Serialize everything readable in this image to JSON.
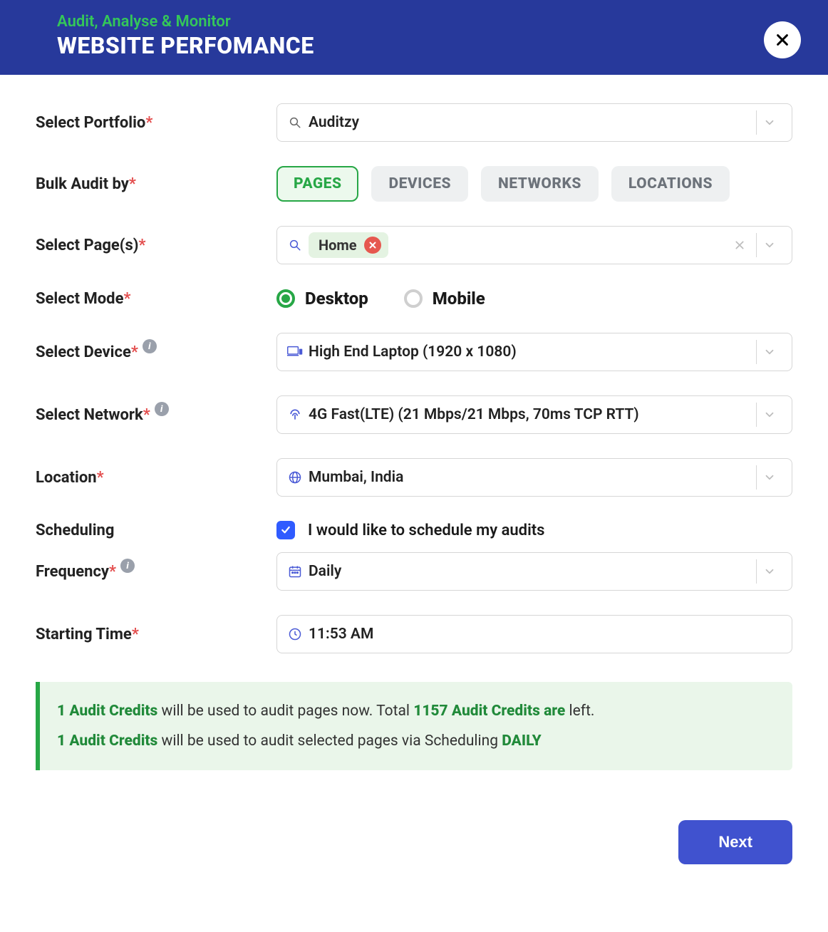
{
  "header": {
    "subtitle": "Audit, Analyse & Monitor",
    "title": "WEBSITE PERFOMANCE"
  },
  "labels": {
    "portfolio": "Select Portfolio",
    "bulk_by": "Bulk Audit by",
    "pages": "Select Page(s)",
    "mode": "Select Mode",
    "device": "Select Device",
    "network": "Select Network",
    "location": "Location",
    "scheduling": "Scheduling",
    "frequency": "Frequency",
    "starting_time": "Starting Time"
  },
  "portfolio": {
    "value": "Auditzy"
  },
  "bulk_tabs": {
    "pages": "PAGES",
    "devices": "DEVICES",
    "networks": "NETWORKS",
    "locations": "LOCATIONS",
    "active": "pages"
  },
  "selected_pages": [
    {
      "label": "Home"
    }
  ],
  "mode": {
    "desktop": "Desktop",
    "mobile": "Mobile",
    "selected": "desktop"
  },
  "device": {
    "value": "High End Laptop (1920 x 1080)"
  },
  "network": {
    "value": "4G Fast(LTE) (21 Mbps/21 Mbps, 70ms TCP RTT)"
  },
  "location": {
    "value": "Mumbai, India"
  },
  "scheduling": {
    "checked": true,
    "label": "I would like to schedule my audits"
  },
  "frequency": {
    "value": "Daily"
  },
  "starting_time": {
    "value": "11:53 AM"
  },
  "notice": {
    "line1_strong1": "1 Audit Credits",
    "line1_mid": " will be used to audit pages now. Total ",
    "line1_strong2": "1157 Audit Credits are",
    "line1_end": " left.",
    "line2_strong1": "1 Audit Credits",
    "line2_mid": " will be used to audit selected pages via Scheduling  ",
    "line2_strong2": "DAILY"
  },
  "footer": {
    "next": "Next"
  }
}
